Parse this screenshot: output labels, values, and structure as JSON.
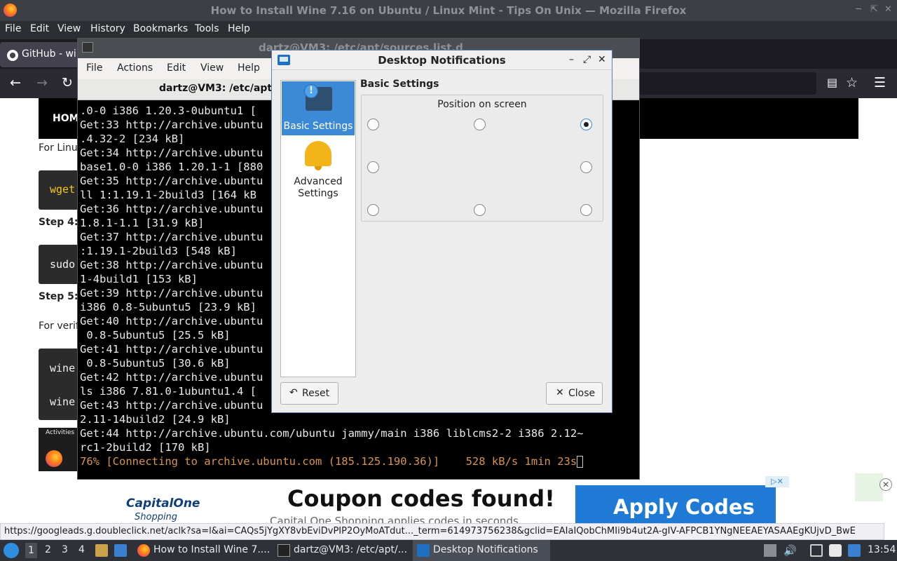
{
  "firefox": {
    "title": "How to Install Wine 7.16 on Ubuntu / Linux Mint - Tips On Unix — Mozilla Firefox",
    "menu": [
      "File",
      "Edit",
      "View",
      "History",
      "Bookmarks",
      "Tools",
      "Help"
    ],
    "tab_label": "GitHub - wir",
    "status_url": "https://googleads.g.doubleclick.net/aclk?sa=l&ai=CAQs5jYgXY8vbEviDvPIP2OyMoATdut..._term=614973756238&gclid=EAIaIQobChMIi9b4ut2A-gIV-AFPCB1YNgNEEAEYASAAEgKUjvD_BwE",
    "icons": [
      "back-icon",
      "forward-icon",
      "reload-icon",
      "reader-icon",
      "bookmark-star-icon",
      "hamburger-menu-icon"
    ]
  },
  "webpage": {
    "nav_home": "HOM",
    "line1": "For Linu",
    "code1": "wget",
    "step4": "Step 4:",
    "code2": "sudo",
    "step5": "Step 5:",
    "verify": "For verif",
    "code3a": "wine",
    "code3b": "wine",
    "thumb_label": "Activities"
  },
  "ad": {
    "brand": "CapitalOne",
    "brand_sub": "Shopping",
    "headline": "Coupon codes found!",
    "subline": "Capital One Shopping applies codes in seconds",
    "cta": "Apply Codes"
  },
  "terminal": {
    "title": "dartz@VM3: /etc/apt/sources.list.d",
    "menu": [
      "File",
      "Actions",
      "Edit",
      "View",
      "Help"
    ],
    "tab_title": "dartz@VM3: /etc/apt/s",
    "lines": [
      ".0-0 i386 1.20.3-0ubuntu1 [",
      "Get:33 http://archive.ubuntu                                                 0",
      ".4.32-2 [234 kB]",
      "Get:34 http://archive.ubuntu                                                 -",
      "base1.0-0 i386 1.20.1-1 [880",
      "Get:35 http://archive.ubuntu                                                 a",
      "ll 1:1.19.1-2build3 [164 kB",
      "Get:36 http://archive.ubuntu",
      "1.8.1-1.1 [31.9 kB]",
      "Get:37 http://archive.ubuntu                                                 1",
      ":1.19.1-2build3 [548 kB]",
      "Get:38 http://archive.ubuntu                                                 .",
      "1-4build1 [153 kB]",
      "Get:39 http://archive.ubuntu",
      "i386 0.8-5ubuntu5 [23.9 kB]",
      "Get:40 http://archive.ubuntu                                                 6",
      " 0.8-5ubuntu5 [25.5 kB]",
      "Get:41 http://archive.ubuntu                                                 6",
      " 0.8-5ubuntu5 [30.6 kB]",
      "Get:42 http://archive.ubuntu                                                 t",
      "ls i386 7.81.0-1ubuntu1.4 [",
      "Get:43 http://archive.ubuntu                                                 .",
      "2.11-14build2 [24.9 kB]",
      "Get:44 http://archive.ubuntu.com/ubuntu jammy/main i386 liblcms2-2 i386 2.12~",
      "rc1-2build2 [170 kB]"
    ],
    "progress_line": "76% [Connecting to archive.ubuntu.com (185.125.190.36)]    528 kB/s 1min 23s"
  },
  "dialog": {
    "title": "Desktop Notifications",
    "sidebar": {
      "basic_label": "Basic Settings",
      "advanced_label": "Advanced\nSettings",
      "selected": "Basic Settings"
    },
    "heading": "Basic Settings",
    "position_title": "Position on screen",
    "positions": {
      "top_left": false,
      "top_center": false,
      "top_right": true,
      "middle_left": false,
      "middle_right": false,
      "bottom_left": false,
      "bottom_center": false,
      "bottom_right": false
    },
    "reset_label": "Reset",
    "close_label": "Close"
  },
  "taskbar": {
    "workspaces": [
      "1",
      "2",
      "3",
      "4"
    ],
    "active_workspace": "1",
    "tasks": [
      {
        "label": "How to Install Wine 7....",
        "icon": "firefox-icon"
      },
      {
        "label": "dartz@VM3: /etc/apt/...",
        "icon": "terminal-icon"
      },
      {
        "label": "Desktop Notifications",
        "icon": "notifications-icon"
      }
    ],
    "active_task": "Desktop Notifications",
    "clock": "13:54"
  },
  "colors": {
    "selection_blue": "#3c8ad6",
    "terminal_progress": "#d8944a",
    "ad_cta": "#1f7ad6",
    "bell_yellow": "#f3b41a"
  }
}
